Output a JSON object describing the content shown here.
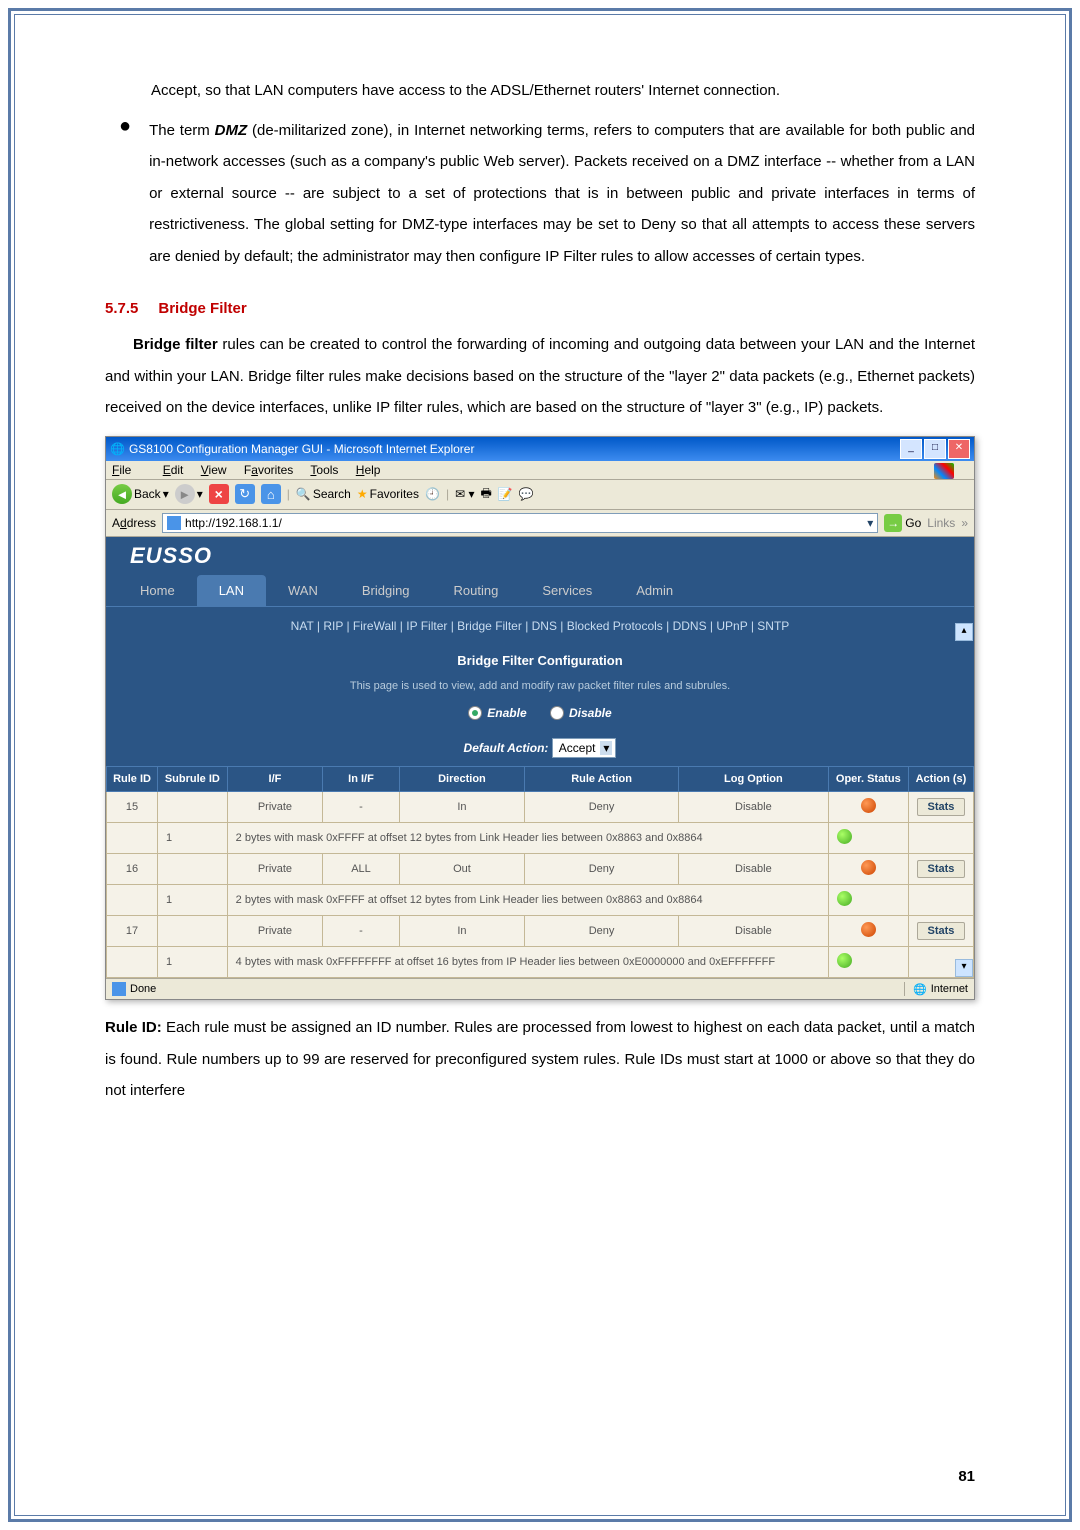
{
  "text": {
    "para1": "Accept, so that LAN computers have access to the ADSL/Ethernet routers' Internet connection.",
    "bullet_pre": "The term ",
    "bullet_bold": "DMZ",
    "bullet_post": " (de-militarized zone), in Internet networking terms, refers to computers that are available for both public and in-network accesses (such as a company's public Web server). Packets received on a DMZ interface -- whether from a LAN or external source -- are subject to a set of protections that is in between public and private interfaces in terms of restrictiveness. The global setting for DMZ-type interfaces may be set to Deny so that all attempts to access these servers are denied by default; the administrator may then configure IP Filter rules to allow accesses of certain types.",
    "section_num": "5.7.5",
    "section_title": "Bridge Filter",
    "para2_bold": "Bridge filter",
    "para2": " rules can be created to control the forwarding of incoming and outgoing data between your LAN and the Internet and within your LAN. Bridge filter rules make decisions based on the structure of the \"layer 2\" data packets (e.g., Ethernet packets) received on the device interfaces, unlike IP filter rules, which are based on the structure of \"layer 3\" (e.g., IP) packets.",
    "rule_id_bold": "Rule ID:",
    "rule_id_text": " Each rule must be assigned an ID number. Rules are processed from lowest to highest on each data packet, until a match is found. Rule numbers up to 99 are reserved for preconfigured system rules. Rule IDs must start at 1000 or above so that they do not interfere",
    "page_num": "81"
  },
  "ie": {
    "title": "GS8100 Configuration Manager GUI - Microsoft Internet Explorer",
    "menu": {
      "file": "File",
      "edit": "Edit",
      "view": "View",
      "favorites": "Favorites",
      "tools": "Tools",
      "help": "Help"
    },
    "toolbar": {
      "back": "Back",
      "search": "Search",
      "favorites": "Favorites"
    },
    "address_label": "Address",
    "address_url": "http://192.168.1.1/",
    "go": "Go",
    "links": "Links",
    "status_done": "Done",
    "status_zone": "Internet"
  },
  "router": {
    "logo": "EUSSO",
    "tabs": [
      "Home",
      "LAN",
      "WAN",
      "Bridging",
      "Routing",
      "Services",
      "Admin"
    ],
    "active_tab": 1,
    "subnav": "NAT  |  RIP  |  FireWall  |  IP Filter  |  Bridge Filter  |  DNS  |  Blocked Protocols  |  DDNS  |  UPnP  |  SNTP",
    "config_header": "Bridge Filter Configuration",
    "config_sub": "This page is used to view, add and modify raw packet filter rules and subrules.",
    "enable": "Enable",
    "disable": "Disable",
    "default_action_label": "Default Action:",
    "default_action_value": "Accept",
    "headers": {
      "rule_id": "Rule ID",
      "subrule_id": "Subrule ID",
      "if": "I/F",
      "in_if": "In I/F",
      "direction": "Direction",
      "rule_action": "Rule Action",
      "log_option": "Log Option",
      "oper_status": "Oper. Status",
      "actions": "Action (s)"
    },
    "rows": [
      {
        "rule_id": "15",
        "subrule_id": "",
        "if": "Private",
        "in_if": "-",
        "direction": "In",
        "rule_action": "Deny",
        "log_option": "Disable",
        "status": "red",
        "action": "Stats"
      },
      {
        "rule_id": "",
        "subrule_id": "1",
        "desc": "2 bytes with mask 0xFFFF at offset 12 bytes from Link Header lies between 0x8863 and 0x8864",
        "status": "green",
        "action": ""
      },
      {
        "rule_id": "16",
        "subrule_id": "",
        "if": "Private",
        "in_if": "ALL",
        "direction": "Out",
        "rule_action": "Deny",
        "log_option": "Disable",
        "status": "red",
        "action": "Stats"
      },
      {
        "rule_id": "",
        "subrule_id": "1",
        "desc": "2 bytes with mask 0xFFFF at offset 12 bytes from Link Header lies between 0x8863 and 0x8864",
        "status": "green",
        "action": ""
      },
      {
        "rule_id": "17",
        "subrule_id": "",
        "if": "Private",
        "in_if": "-",
        "direction": "In",
        "rule_action": "Deny",
        "log_option": "Disable",
        "status": "red",
        "action": "Stats"
      },
      {
        "rule_id": "",
        "subrule_id": "1",
        "desc": "4 bytes with mask 0xFFFFFFFF at offset 16 bytes from IP Header lies between 0xE0000000 and 0xEFFFFFFF",
        "status": "green",
        "action": ""
      }
    ]
  }
}
